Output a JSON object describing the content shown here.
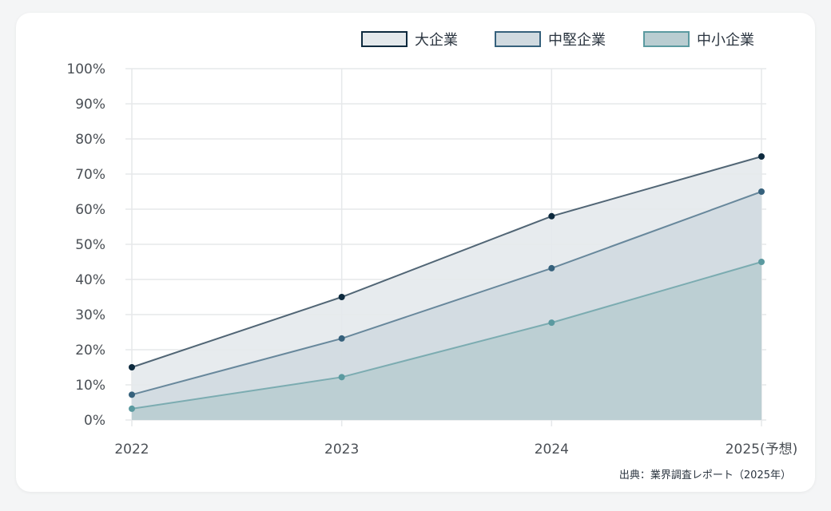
{
  "chart_data": {
    "type": "area",
    "x": [
      "2022",
      "2023",
      "2024",
      "2025(予想)"
    ],
    "series": [
      {
        "name": "大企業",
        "values": [
          15,
          35,
          58,
          75
        ],
        "color": "#0d2a3e",
        "fill": "#e4e9ec"
      },
      {
        "name": "中堅企業",
        "values": [
          7.2,
          23.2,
          43.2,
          65
        ],
        "color": "#36617c",
        "fill": "#d0dae0"
      },
      {
        "name": "中小企業",
        "values": [
          3.2,
          12.2,
          27.7,
          45
        ],
        "color": "#5b9aa0",
        "fill": "#b9cdd1"
      }
    ],
    "y_ticks": [
      "0%",
      "10%",
      "20%",
      "30%",
      "40%",
      "50%",
      "60%",
      "70%",
      "80%",
      "90%",
      "100%"
    ],
    "ylim": [
      0,
      100
    ],
    "grid": true,
    "legend": "top-right",
    "source": "出典：業界調査レポート（2025年）"
  }
}
